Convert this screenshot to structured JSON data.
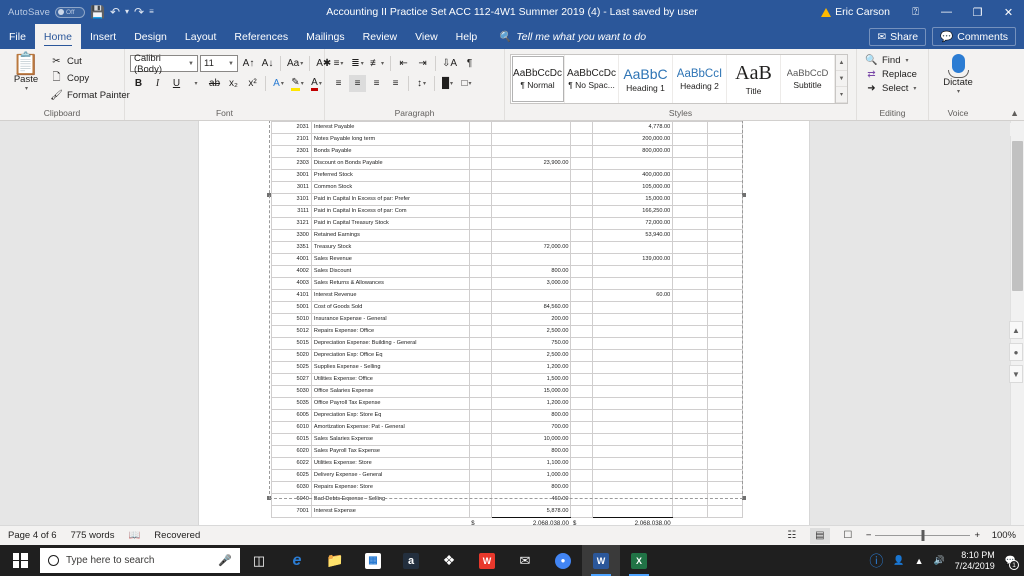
{
  "titlebar": {
    "autosave_label": "AutoSave",
    "autosave_state": "Off",
    "save_icon": "save-icon",
    "undo_icon": "undo-icon",
    "redo_icon": "redo-icon",
    "qat_more_icon": "quick-access-more-icon",
    "document_title": "Accounting II Practice Set ACC 112-4W1 Summer 2019 (4)  -  Last saved by user",
    "account_name": "Eric Carson",
    "ribbon_display_icon": "ribbon-display-options-icon",
    "minimize": "—",
    "restore": "❐",
    "close": "✕"
  },
  "tabs": [
    {
      "label": "File",
      "active": false
    },
    {
      "label": "Home",
      "active": true
    },
    {
      "label": "Insert",
      "active": false
    },
    {
      "label": "Design",
      "active": false
    },
    {
      "label": "Layout",
      "active": false
    },
    {
      "label": "References",
      "active": false
    },
    {
      "label": "Mailings",
      "active": false
    },
    {
      "label": "Review",
      "active": false
    },
    {
      "label": "View",
      "active": false
    },
    {
      "label": "Help",
      "active": false
    }
  ],
  "tellme": {
    "placeholder": "Tell me what you want to do",
    "icon": "search-icon"
  },
  "share": {
    "label": "Share",
    "icon": "share-icon"
  },
  "comments": {
    "label": "Comments",
    "icon": "comment-icon"
  },
  "ribbon": {
    "clipboard": {
      "title": "Clipboard",
      "paste": "Paste",
      "cut": "Cut",
      "copy": "Copy",
      "format_painter": "Format Painter"
    },
    "font": {
      "title": "Font",
      "font_name": "Calibri (Body)",
      "font_size": "11",
      "grow": "A",
      "shrink": "A",
      "change_case": "Aa",
      "clear_formatting": "A",
      "bold": "B",
      "italic": "I",
      "underline": "U",
      "strikethrough": "ab",
      "subscript": "x₂",
      "superscript": "x²",
      "text_effects": "A",
      "highlight": "A",
      "font_color": "A"
    },
    "paragraph": {
      "title": "Paragraph"
    },
    "styles": {
      "title": "Styles",
      "items": [
        {
          "preview": "AaBbCcDc",
          "name": "¶ Normal",
          "kind": "normal",
          "selected": true
        },
        {
          "preview": "AaBbCcDc",
          "name": "¶ No Spac...",
          "kind": "normal",
          "selected": false
        },
        {
          "preview": "AaBbC",
          "name": "Heading 1",
          "kind": "h1",
          "selected": false
        },
        {
          "preview": "AaBbCcI",
          "name": "Heading 2",
          "kind": "h2",
          "selected": false
        },
        {
          "preview": "AaB",
          "name": "Title",
          "kind": "title",
          "selected": false
        },
        {
          "preview": "AaBbCcD",
          "name": "Subtitle",
          "kind": "sub",
          "selected": false
        }
      ]
    },
    "editing": {
      "title": "Editing",
      "find": "Find",
      "replace": "Replace",
      "select": "Select"
    },
    "voice": {
      "title": "Voice",
      "dictate": "Dictate"
    }
  },
  "document": {
    "columns": [
      "account",
      "name",
      "blank1",
      "debit",
      "blank2",
      "credit",
      "blank3",
      "blank4"
    ],
    "rows": [
      {
        "account": "2031",
        "name": "Interest Payable",
        "debit": "",
        "credit": "4,778.00"
      },
      {
        "account": "2101",
        "name": "Notes Payable long term",
        "debit": "",
        "credit": "200,000.00"
      },
      {
        "account": "2301",
        "name": "Bonds Payable",
        "debit": "",
        "credit": "800,000.00"
      },
      {
        "account": "2303",
        "name": "Discount on Bonds Payable",
        "debit": "23,900.00",
        "credit": ""
      },
      {
        "account": "3001",
        "name": "Preferred Stock",
        "debit": "",
        "credit": "400,000.00"
      },
      {
        "account": "3011",
        "name": "Common Stock",
        "debit": "",
        "credit": "105,000.00"
      },
      {
        "account": "3101",
        "name": "Paid in Capital In Excess of par:  Prefer",
        "debit": "",
        "credit": "15,000.00"
      },
      {
        "account": "3111",
        "name": "Paid in Capital In Excess of par:  Com",
        "debit": "",
        "credit": "166,250.00"
      },
      {
        "account": "3121",
        "name": "Paid in Capital  Treasury Stock",
        "debit": "",
        "credit": "72,000.00"
      },
      {
        "account": "3300",
        "name": "Retained Earnings",
        "debit": "",
        "credit": "53,940.00"
      },
      {
        "account": "3351",
        "name": "Treasury Stock",
        "debit": "72,000.00",
        "credit": ""
      },
      {
        "account": "4001",
        "name": "Sales Revenue",
        "debit": "",
        "credit": "139,000.00"
      },
      {
        "account": "4002",
        "name": "Sales Discount",
        "debit": "800.00",
        "credit": ""
      },
      {
        "account": "4003",
        "name": "Sales Returns & Allowances",
        "debit": "3,000.00",
        "credit": ""
      },
      {
        "account": "4101",
        "name": "Interest Revenue",
        "debit": "",
        "credit": "60.00"
      },
      {
        "account": "5001",
        "name": "Cost of Goods Sold",
        "debit": "84,560.00",
        "credit": ""
      },
      {
        "account": "5010",
        "name": "Insurance Expense - General",
        "debit": "200.00",
        "credit": ""
      },
      {
        "account": "5012",
        "name": "Repairs Expense:  Office",
        "debit": "2,500.00",
        "credit": ""
      },
      {
        "account": "5015",
        "name": "Depreciation Expense:  Building - General",
        "debit": "750.00",
        "credit": ""
      },
      {
        "account": "5020",
        "name": "Depreciation Exp:  Office Eq",
        "debit": "2,500.00",
        "credit": ""
      },
      {
        "account": "5025",
        "name": "Supplies Expense - Selling",
        "debit": "1,200.00",
        "credit": ""
      },
      {
        "account": "5027",
        "name": "Utilities Expense:  Office",
        "debit": "1,500.00",
        "credit": ""
      },
      {
        "account": "5030",
        "name": "Office Salaries Expense",
        "debit": "15,000.00",
        "credit": ""
      },
      {
        "account": "5035",
        "name": "Office Payroll Tax Expense",
        "debit": "1,200.00",
        "credit": ""
      },
      {
        "account": "6005",
        "name": "Depreciation Exp:  Store Eq",
        "debit": "800.00",
        "credit": ""
      },
      {
        "account": "6010",
        "name": "Amortization Expense:  Pat - General",
        "debit": "700.00",
        "credit": ""
      },
      {
        "account": "6015",
        "name": "Sales Salaries Expense",
        "debit": "10,000.00",
        "credit": ""
      },
      {
        "account": "6020",
        "name": "Sales Payroll Tax Expense",
        "debit": "800.00",
        "credit": ""
      },
      {
        "account": "6022",
        "name": "Utilities Expense:  Store",
        "debit": "1,100.00",
        "credit": ""
      },
      {
        "account": "6025",
        "name": "Delivery Expense - General",
        "debit": "1,000.00",
        "credit": ""
      },
      {
        "account": "6030",
        "name": "Repairs Expense:  Store",
        "debit": "800.00",
        "credit": ""
      },
      {
        "account": "6040",
        "name": "Bad Debts Expense - Selling",
        "debit": "460.00",
        "credit": ""
      },
      {
        "account": "7001",
        "name": "Interest Expense",
        "debit": "5,878.00",
        "credit": ""
      }
    ],
    "totals": {
      "debit_symbol": "$",
      "debit_total": "2,068,038.00",
      "credit_symbol": "$",
      "credit_total": "2,068,038.00"
    }
  },
  "statusbar": {
    "page": "Page 4 of 6",
    "words": "775 words",
    "proofing_icon": "proofing-errors-icon",
    "recovered": "Recovered",
    "view_read": "read-mode-icon",
    "view_print": "print-layout-icon",
    "view_web": "web-layout-icon",
    "zoom_out": "−",
    "zoom_in": "+",
    "zoom_level": "100%"
  },
  "taskbar": {
    "start_icon": "windows-start-icon",
    "search_placeholder": "Type here to search",
    "search_icon": "cortana-circle-icon",
    "mic_icon": "microphone-icon",
    "taskview_icon": "task-view-icon",
    "apps": [
      {
        "name": "edge-icon",
        "glyph": "e",
        "color": "#2b7cd3",
        "running": false
      },
      {
        "name": "file-explorer-icon",
        "glyph": "☰",
        "color": "#ffc83d",
        "running": false
      },
      {
        "name": "microsoft-store-icon",
        "glyph": "⊞",
        "color": "#ffffff",
        "running": false
      },
      {
        "name": "amazon-icon",
        "glyph": "a",
        "color": "#232f3e",
        "running": false
      },
      {
        "name": "dropbox-icon",
        "glyph": "❖",
        "color": "#ffffff",
        "running": false
      },
      {
        "name": "wps-office-icon",
        "glyph": "W",
        "color": "#e8382c",
        "running": false
      },
      {
        "name": "mail-icon",
        "glyph": "✉",
        "color": "#ffffff",
        "running": false
      },
      {
        "name": "chrome-icon",
        "glyph": "●",
        "color": "#4285f4",
        "running": false
      },
      {
        "name": "word-icon",
        "glyph": "W",
        "color": "#2b579a",
        "running": true
      },
      {
        "name": "excel-icon",
        "glyph": "X",
        "color": "#217346",
        "running": true
      }
    ],
    "tray": {
      "help_icon": "help-circle-icon",
      "people_icon": "people-icon",
      "chevron_icon": "show-hidden-icons-icon",
      "volume_icon": "volume-icon",
      "time": "8:10 PM",
      "date": "7/24/2019",
      "notifications_icon": "action-center-icon",
      "notifications_count": "1"
    }
  },
  "colors": {
    "word_blue": "#2b579a",
    "ribbon_bg": "#f3f2f1",
    "workspace_gray": "#e6e6e6",
    "accent_heading": "#2e74b5"
  }
}
